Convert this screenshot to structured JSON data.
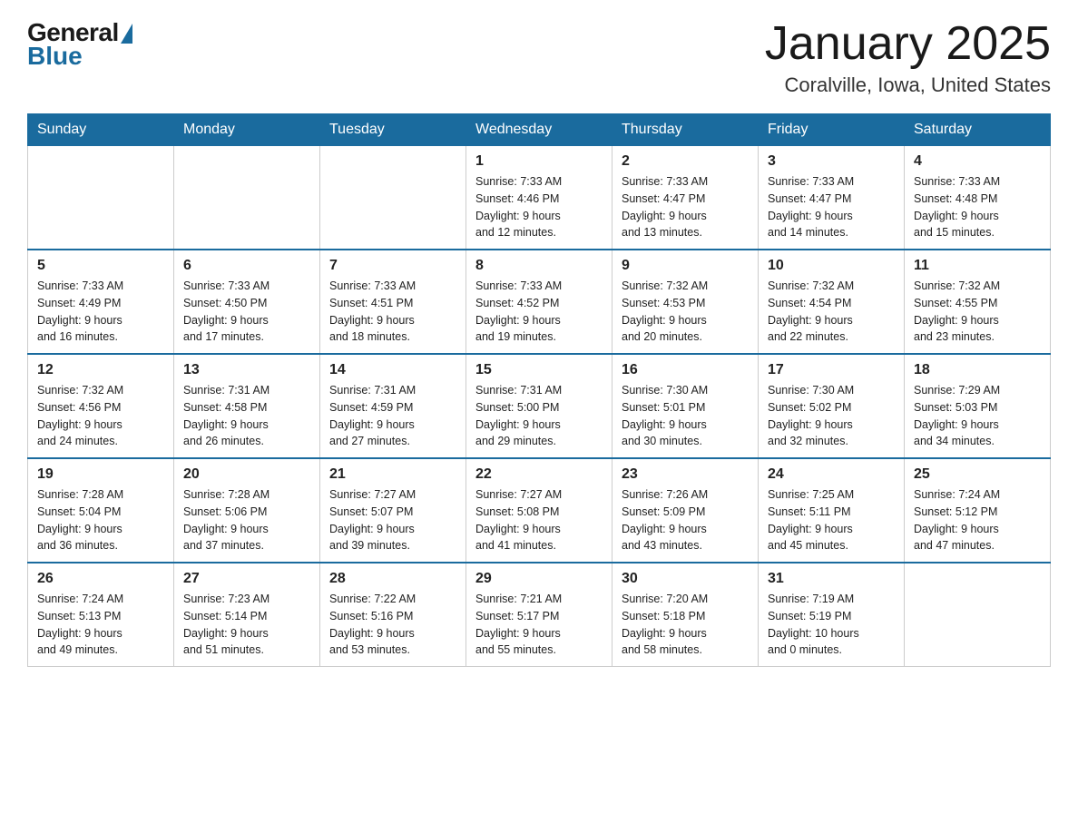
{
  "header": {
    "logo_general": "General",
    "logo_blue": "Blue",
    "title": "January 2025",
    "subtitle": "Coralville, Iowa, United States"
  },
  "days_of_week": [
    "Sunday",
    "Monday",
    "Tuesday",
    "Wednesday",
    "Thursday",
    "Friday",
    "Saturday"
  ],
  "weeks": [
    [
      {
        "day": "",
        "info": ""
      },
      {
        "day": "",
        "info": ""
      },
      {
        "day": "",
        "info": ""
      },
      {
        "day": "1",
        "info": "Sunrise: 7:33 AM\nSunset: 4:46 PM\nDaylight: 9 hours\nand 12 minutes."
      },
      {
        "day": "2",
        "info": "Sunrise: 7:33 AM\nSunset: 4:47 PM\nDaylight: 9 hours\nand 13 minutes."
      },
      {
        "day": "3",
        "info": "Sunrise: 7:33 AM\nSunset: 4:47 PM\nDaylight: 9 hours\nand 14 minutes."
      },
      {
        "day": "4",
        "info": "Sunrise: 7:33 AM\nSunset: 4:48 PM\nDaylight: 9 hours\nand 15 minutes."
      }
    ],
    [
      {
        "day": "5",
        "info": "Sunrise: 7:33 AM\nSunset: 4:49 PM\nDaylight: 9 hours\nand 16 minutes."
      },
      {
        "day": "6",
        "info": "Sunrise: 7:33 AM\nSunset: 4:50 PM\nDaylight: 9 hours\nand 17 minutes."
      },
      {
        "day": "7",
        "info": "Sunrise: 7:33 AM\nSunset: 4:51 PM\nDaylight: 9 hours\nand 18 minutes."
      },
      {
        "day": "8",
        "info": "Sunrise: 7:33 AM\nSunset: 4:52 PM\nDaylight: 9 hours\nand 19 minutes."
      },
      {
        "day": "9",
        "info": "Sunrise: 7:32 AM\nSunset: 4:53 PM\nDaylight: 9 hours\nand 20 minutes."
      },
      {
        "day": "10",
        "info": "Sunrise: 7:32 AM\nSunset: 4:54 PM\nDaylight: 9 hours\nand 22 minutes."
      },
      {
        "day": "11",
        "info": "Sunrise: 7:32 AM\nSunset: 4:55 PM\nDaylight: 9 hours\nand 23 minutes."
      }
    ],
    [
      {
        "day": "12",
        "info": "Sunrise: 7:32 AM\nSunset: 4:56 PM\nDaylight: 9 hours\nand 24 minutes."
      },
      {
        "day": "13",
        "info": "Sunrise: 7:31 AM\nSunset: 4:58 PM\nDaylight: 9 hours\nand 26 minutes."
      },
      {
        "day": "14",
        "info": "Sunrise: 7:31 AM\nSunset: 4:59 PM\nDaylight: 9 hours\nand 27 minutes."
      },
      {
        "day": "15",
        "info": "Sunrise: 7:31 AM\nSunset: 5:00 PM\nDaylight: 9 hours\nand 29 minutes."
      },
      {
        "day": "16",
        "info": "Sunrise: 7:30 AM\nSunset: 5:01 PM\nDaylight: 9 hours\nand 30 minutes."
      },
      {
        "day": "17",
        "info": "Sunrise: 7:30 AM\nSunset: 5:02 PM\nDaylight: 9 hours\nand 32 minutes."
      },
      {
        "day": "18",
        "info": "Sunrise: 7:29 AM\nSunset: 5:03 PM\nDaylight: 9 hours\nand 34 minutes."
      }
    ],
    [
      {
        "day": "19",
        "info": "Sunrise: 7:28 AM\nSunset: 5:04 PM\nDaylight: 9 hours\nand 36 minutes."
      },
      {
        "day": "20",
        "info": "Sunrise: 7:28 AM\nSunset: 5:06 PM\nDaylight: 9 hours\nand 37 minutes."
      },
      {
        "day": "21",
        "info": "Sunrise: 7:27 AM\nSunset: 5:07 PM\nDaylight: 9 hours\nand 39 minutes."
      },
      {
        "day": "22",
        "info": "Sunrise: 7:27 AM\nSunset: 5:08 PM\nDaylight: 9 hours\nand 41 minutes."
      },
      {
        "day": "23",
        "info": "Sunrise: 7:26 AM\nSunset: 5:09 PM\nDaylight: 9 hours\nand 43 minutes."
      },
      {
        "day": "24",
        "info": "Sunrise: 7:25 AM\nSunset: 5:11 PM\nDaylight: 9 hours\nand 45 minutes."
      },
      {
        "day": "25",
        "info": "Sunrise: 7:24 AM\nSunset: 5:12 PM\nDaylight: 9 hours\nand 47 minutes."
      }
    ],
    [
      {
        "day": "26",
        "info": "Sunrise: 7:24 AM\nSunset: 5:13 PM\nDaylight: 9 hours\nand 49 minutes."
      },
      {
        "day": "27",
        "info": "Sunrise: 7:23 AM\nSunset: 5:14 PM\nDaylight: 9 hours\nand 51 minutes."
      },
      {
        "day": "28",
        "info": "Sunrise: 7:22 AM\nSunset: 5:16 PM\nDaylight: 9 hours\nand 53 minutes."
      },
      {
        "day": "29",
        "info": "Sunrise: 7:21 AM\nSunset: 5:17 PM\nDaylight: 9 hours\nand 55 minutes."
      },
      {
        "day": "30",
        "info": "Sunrise: 7:20 AM\nSunset: 5:18 PM\nDaylight: 9 hours\nand 58 minutes."
      },
      {
        "day": "31",
        "info": "Sunrise: 7:19 AM\nSunset: 5:19 PM\nDaylight: 10 hours\nand 0 minutes."
      },
      {
        "day": "",
        "info": ""
      }
    ]
  ]
}
